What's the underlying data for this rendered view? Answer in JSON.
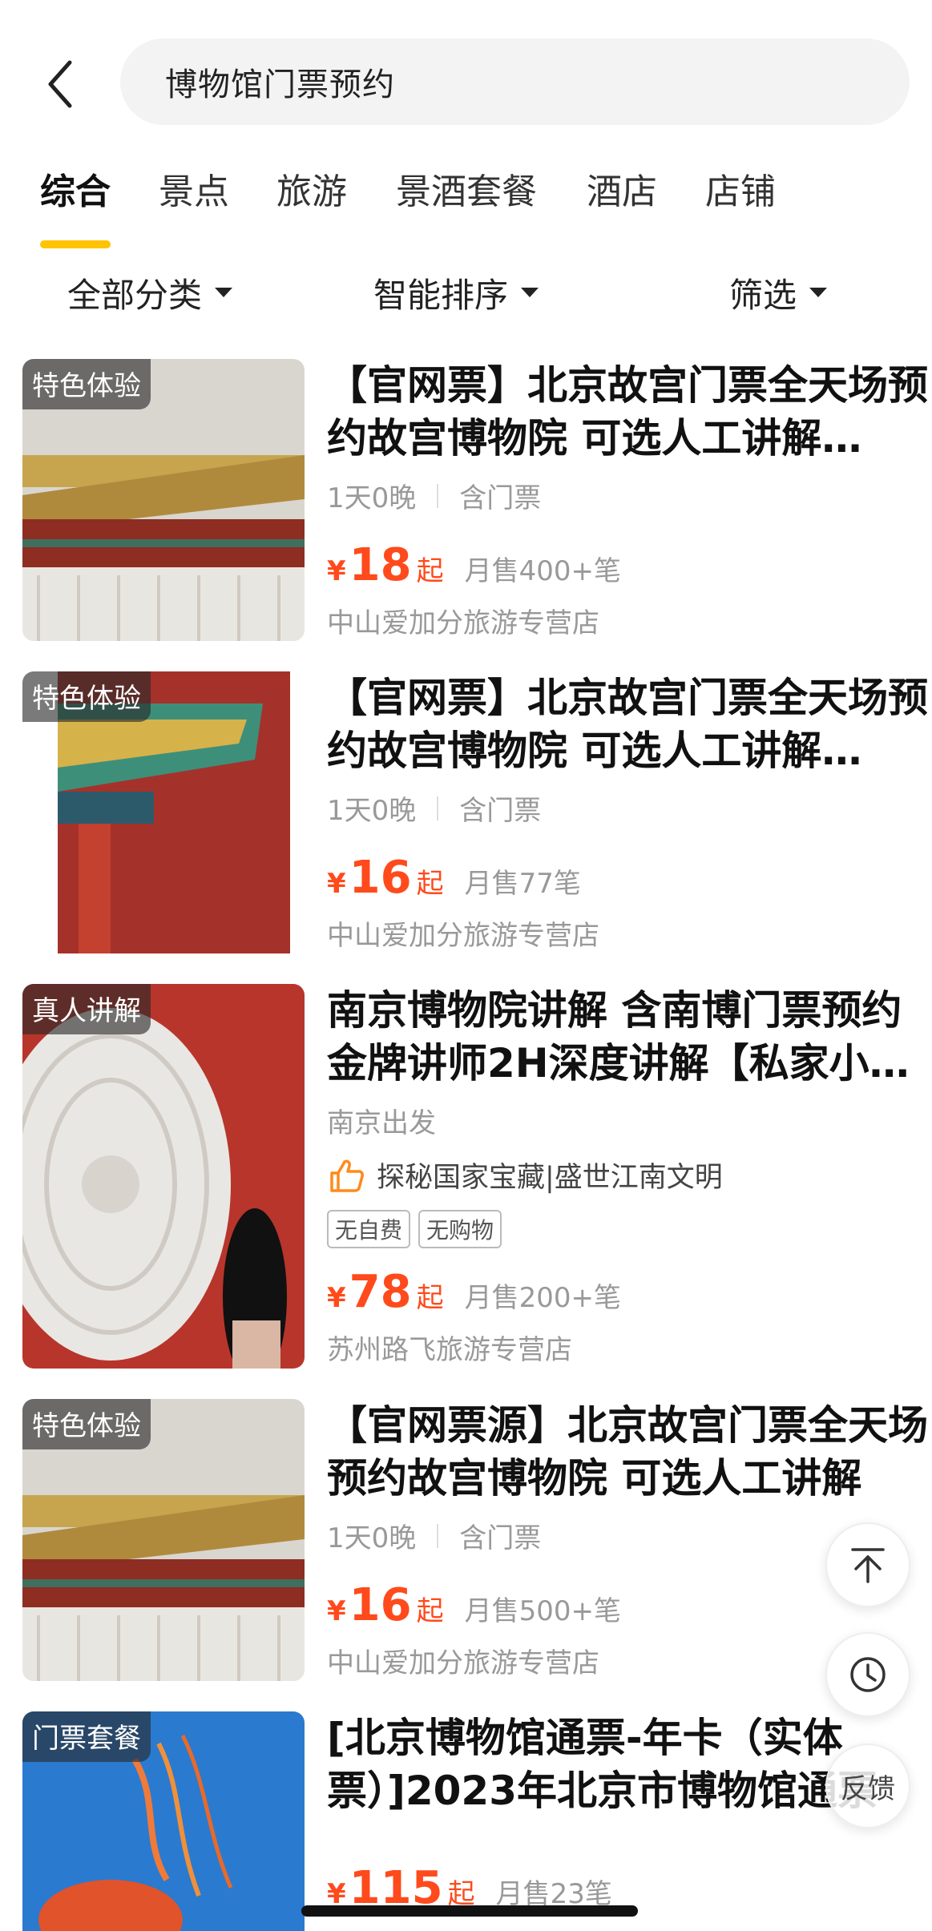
{
  "search": {
    "query": "博物馆门票预约"
  },
  "tabs": [
    {
      "label": "综合"
    },
    {
      "label": "景点"
    },
    {
      "label": "旅游"
    },
    {
      "label": "景酒套餐"
    },
    {
      "label": "酒店"
    },
    {
      "label": "店铺"
    }
  ],
  "filters": [
    {
      "label": "全部分类"
    },
    {
      "label": "智能排序"
    },
    {
      "label": "筛选"
    }
  ],
  "products": [
    {
      "badge": "特色体验",
      "title": "【官网票】北京故宫门票全天场预约故宫博物院 可选人工讲解…",
      "duration": "1天0晚",
      "includes": "含门票",
      "yen": "¥",
      "price": "18",
      "price_suffix": "起",
      "sold": "月售400+笔",
      "shop": "中山爱加分旅游专营店"
    },
    {
      "badge": "特色体验",
      "title": "【官网票】北京故宫门票全天场预约故宫博物院 可选人工讲解…",
      "duration": "1天0晚",
      "includes": "含门票",
      "yen": "¥",
      "price": "16",
      "price_suffix": "起",
      "sold": "月售77笔",
      "shop": "中山爱加分旅游专营店"
    },
    {
      "badge": "真人讲解",
      "title": "南京博物院讲解 含南博门票预约 金牌讲师2H深度讲解【私家小…",
      "departure": "南京出发",
      "highlight": "探秘国家宝藏|盛世江南文明",
      "tags": [
        "无自费",
        "无购物"
      ],
      "yen": "¥",
      "price": "78",
      "price_suffix": "起",
      "sold": "月售200+笔",
      "shop": "苏州路飞旅游专营店"
    },
    {
      "badge": "特色体验",
      "title": "【官网票源】北京故宫门票全天场预约故宫博物院 可选人工讲解",
      "duration": "1天0晚",
      "includes": "含门票",
      "yen": "¥",
      "price": "16",
      "price_suffix": "起",
      "sold": "月售500+笔",
      "shop": "中山爱加分旅游专营店"
    },
    {
      "badge": "门票套餐",
      "title": "[北京博物馆通票-年卡（实体票）]2023年北京市博物馆通票",
      "yen": "¥",
      "price": "115",
      "price_suffix": "起",
      "sold": "月售23笔"
    }
  ],
  "floating": {
    "feedback_label": "反馈"
  },
  "colors": {
    "accent": "#ffc300",
    "price": "#ff4a1c"
  },
  "icons": [
    "back-arrow-icon",
    "caret-down-icon",
    "thumbs-up-icon",
    "back-to-top-icon",
    "history-clock-icon"
  ]
}
